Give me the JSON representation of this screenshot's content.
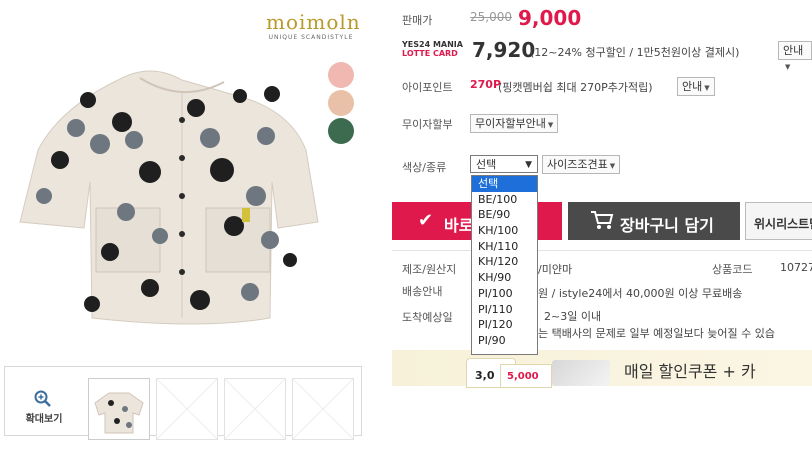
{
  "brand": {
    "name": "moimoln",
    "subtitle": "UNIQUE SCANDISTYLE"
  },
  "colors": {
    "accent": "#e0194c",
    "beige": "#ece5dc",
    "pink": "#f0b8b0",
    "salmon": "#e9c0a8",
    "green": "#3d6b50",
    "select_blue": "#1e6fd9"
  },
  "thumbbar": {
    "zoom_label": "확대보기"
  },
  "price": {
    "label": "판매가",
    "original": "25,000",
    "sale": "9,000"
  },
  "card": {
    "line1": "YES24 MANIA",
    "line2": "LOTTE CARD",
    "price": "7,920",
    "desc": "(12~24% 청구할인 / 1만5천원이상 결제시)",
    "guide": "안내"
  },
  "ipoint": {
    "label": "아이포인트",
    "value": "270P",
    "desc": "(핑캣멤버쉽 최대 270P추가적립)",
    "guide": "안내"
  },
  "installment": {
    "label": "무이자할부",
    "button": "무이자할부안내"
  },
  "option": {
    "label": "색상/종류",
    "selected": "선택",
    "size_chart": "사이즈조견표"
  },
  "dropdown_options": [
    "선택",
    "BE/100",
    "BE/90",
    "KH/100",
    "KH/110",
    "KH/120",
    "KH/90",
    "PI/100",
    "PI/110",
    "PI/120",
    "PI/90"
  ],
  "buttons": {
    "buy": "바로구매",
    "cart": "장바구니 담기",
    "wish": "위시리스트담"
  },
  "details": {
    "maker_label": "제조/원산지",
    "maker_value": "/미얀마",
    "code_label": "상품코드",
    "code_value": "10727",
    "shipping_label": "배송안내",
    "shipping_value": "원 / istyle24에서 40,000원 이상 무료배송",
    "arrival_label": "도착예상일",
    "arrival_value": "2~3일 이내",
    "arrival_note": "는 택배사의 문제로 일부 예정일보다 늦어질 수 있습"
  },
  "banner": {
    "text": "매일 할인쿠폰 + 카",
    "coupon_a": "3,0",
    "coupon_b": "5,000"
  }
}
